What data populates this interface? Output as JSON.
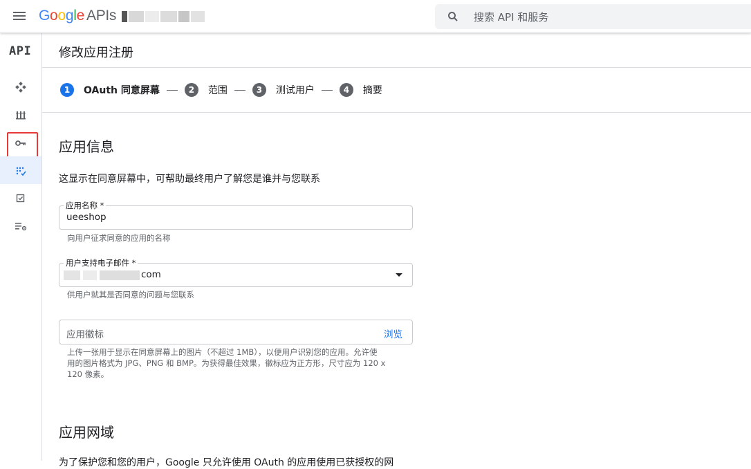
{
  "header": {
    "logo_google": [
      "G",
      "o",
      "o",
      "g",
      "l",
      "e"
    ],
    "logo_apis": "APIs",
    "search_placeholder": "搜索 API 和服务"
  },
  "rail": {
    "brand": "API",
    "items": [
      {
        "icon": "dashboard-diamond-icon"
      },
      {
        "icon": "library-icon"
      },
      {
        "icon": "key-icon",
        "highlighted": true
      },
      {
        "icon": "oauth-consent-icon",
        "active": true
      },
      {
        "icon": "checkbox-icon"
      },
      {
        "icon": "settings-list-icon"
      }
    ]
  },
  "page": {
    "title": "修改应用注册",
    "steps": [
      {
        "num": "1",
        "label": "OAuth 同意屏幕",
        "active": true
      },
      {
        "num": "2",
        "label": "范围"
      },
      {
        "num": "3",
        "label": "测试用户"
      },
      {
        "num": "4",
        "label": "摘要"
      }
    ],
    "section1_title": "应用信息",
    "section1_desc": "这显示在同意屏幕中，可帮助最终用户了解您是谁并与您联系",
    "app_name": {
      "label": "应用名称 *",
      "value": "ueeshop",
      "hint": "向用户征求同意的应用的名称"
    },
    "support_email": {
      "label": "用户支持电子邮件 *",
      "value_suffix": "com",
      "hint": "供用户就其是否同意的问题与您联系"
    },
    "logo_field": {
      "placeholder": "应用徽标",
      "browse": "浏览",
      "hint_line1": "上传一张用于显示在同意屏幕上的图片（不超过 1MB），以便用户识别您的应用。允许使",
      "hint_line2": "用的图片格式为 JPG、PNG 和 BMP。为获得最佳效果，徽标应为正方形，尺寸应为 120 x",
      "hint_line3": "120 像素。"
    },
    "section2_title": "应用网域",
    "section2_desc": "为了保护您和您的用户，Google 只允许使用 OAuth 的应用使用已获授权的网"
  }
}
